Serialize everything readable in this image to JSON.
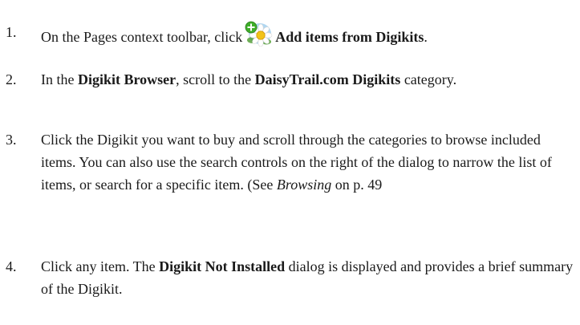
{
  "steps": [
    {
      "number": "1.",
      "before_icon": "On the Pages context toolbar, click",
      "icon": "add-digikit-icon",
      "bold_label": "Add items from Digikits",
      "end": "."
    },
    {
      "number": "2.",
      "t1": "In the ",
      "b1": "Digikit Browser",
      "t2": ", scroll to the ",
      "b2": "DaisyTrail.com Digikits",
      "t3": " category."
    },
    {
      "number": "3.",
      "t1": "Click the Digikit you want to buy and scroll through the categories to browse included items. You can also use the search controls on the right of the dialog to narrow the list of items, or search for a specific item. (See ",
      "i1": "Browsing",
      "t2": " on p. 49"
    },
    {
      "number": "4.",
      "t1": "Click any item. The ",
      "b1": "Digikit Not Installed",
      "t2": " dialog is displayed and provides a brief summary of the Digikit."
    }
  ],
  "colors": {
    "icon_green": "#3fae2a",
    "icon_yellow": "#f2c318",
    "icon_blue": "#6fb6e6"
  }
}
